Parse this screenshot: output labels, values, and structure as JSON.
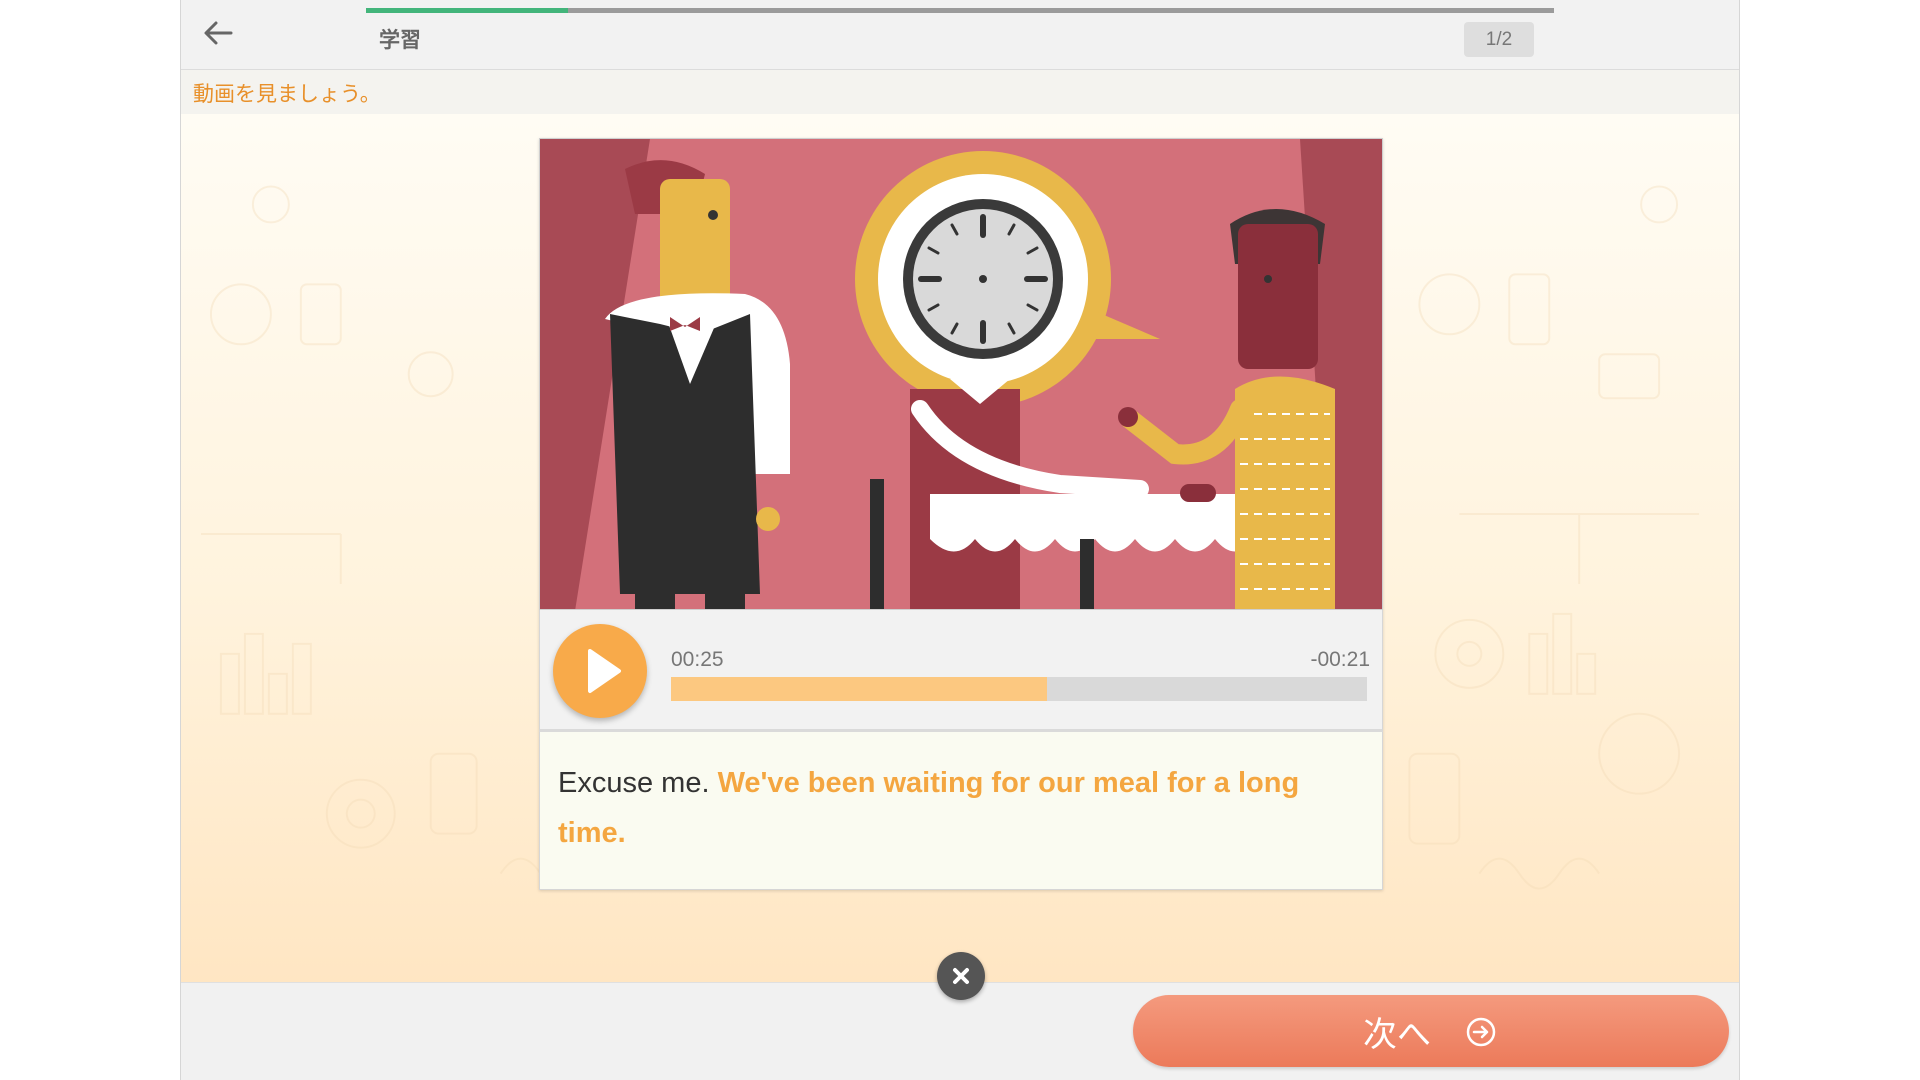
{
  "header": {
    "title": "学習",
    "page_indicator": "1/2",
    "progress": 0.17,
    "progress_color": "#43b57b"
  },
  "instruction": "動画を見ましょう。",
  "player": {
    "elapsed": "00:25",
    "remaining": "-00:21",
    "played_fraction": 0.54,
    "accent_color": "#f8aa4a"
  },
  "transcript": {
    "plain": "Excuse me.",
    "highlighted": "We've been waiting for our meal for a long time."
  },
  "footer": {
    "next_label": "次へ"
  },
  "icons": {
    "back": "arrow-left-icon",
    "play": "play-icon",
    "close": "close-icon",
    "next": "arrow-circle-right-icon"
  }
}
